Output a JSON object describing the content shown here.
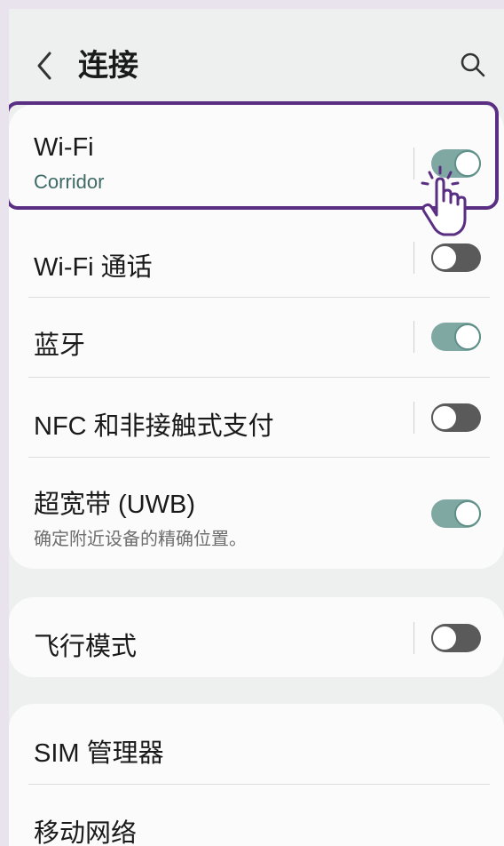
{
  "header": {
    "title": "连接",
    "back_icon": "chevron-left-icon",
    "search_icon": "search-icon"
  },
  "settings": {
    "wifi": {
      "title": "Wi-Fi",
      "subtitle": "Corridor",
      "toggle": "on"
    },
    "wifi_calling": {
      "title": "Wi-Fi 通话",
      "toggle": "off"
    },
    "bluetooth": {
      "title": "蓝牙",
      "toggle": "on"
    },
    "nfc": {
      "title": "NFC 和非接触式支付",
      "toggle": "off"
    },
    "uwb": {
      "title": "超宽带 (UWB)",
      "subtitle": "确定附近设备的精确位置。",
      "toggle": "on"
    },
    "airplane": {
      "title": "飞行模式",
      "toggle": "off"
    },
    "sim": {
      "title": "SIM 管理器"
    },
    "mobile": {
      "title": "移动网络"
    }
  },
  "colors": {
    "accent": "#7fa8a2",
    "highlight": "#5a2e82",
    "toggle_off": "#5a5a5a",
    "background": "#eef0f0"
  },
  "overlay": {
    "pointer_icon": "hand-pointer-icon"
  }
}
